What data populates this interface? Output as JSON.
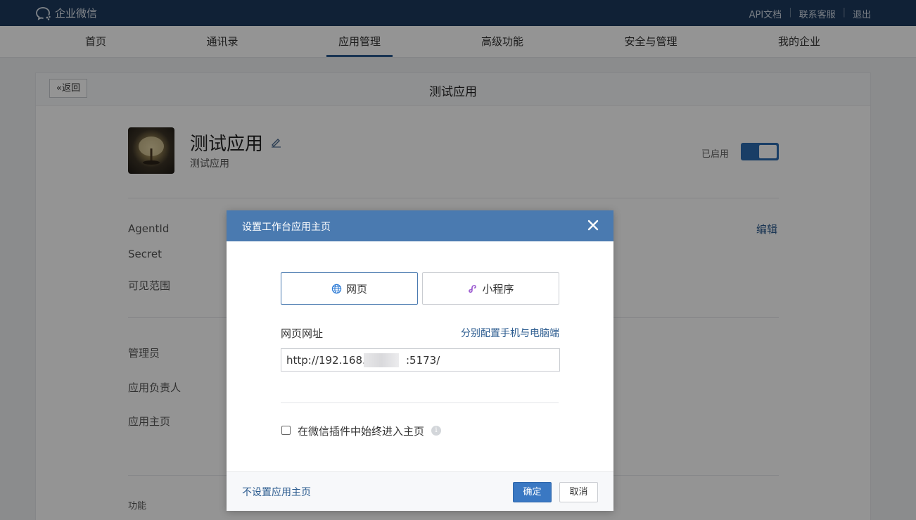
{
  "topbar": {
    "logo_text": "企业微信",
    "links": [
      "API文档",
      "联系客服",
      "退出"
    ]
  },
  "nav": {
    "items": [
      {
        "label": "首页",
        "active": false
      },
      {
        "label": "通讯录",
        "active": false
      },
      {
        "label": "应用管理",
        "active": true
      },
      {
        "label": "高级功能",
        "active": false
      },
      {
        "label": "安全与管理",
        "active": false
      },
      {
        "label": "我的企业",
        "active": false
      }
    ]
  },
  "page": {
    "back_label": "返回",
    "title": "测试应用",
    "app_name": "测试应用",
    "app_description": "测试应用",
    "enabled_label": "已启用",
    "enabled": true,
    "edit_label": "编辑",
    "fields": {
      "agentid": "AgentId",
      "secret": "Secret",
      "visible_range": "可见范围",
      "admin": "管理员",
      "owner": "应用负责人",
      "homepage": "应用主页",
      "features": "功能"
    }
  },
  "dialog": {
    "title": "设置工作台应用主页",
    "tabs": [
      {
        "label": "网页",
        "icon": "globe-icon",
        "selected": true
      },
      {
        "label": "小程序",
        "icon": "mini-program-icon",
        "selected": false
      }
    ],
    "url_label": "网页网址",
    "split_config_link": "分别配置手机与电脑端",
    "url_value": "http://192.168.            :5173/",
    "checkbox_label": "在微信插件中始终进入主页",
    "checkbox_checked": false,
    "no_homepage_link": "不设置应用主页",
    "ok_label": "确定",
    "cancel_label": "取消"
  },
  "colors": {
    "topbar": "#1c3a5e",
    "dialog_header": "#4a7ab0",
    "primary_button": "#3a78c3",
    "link": "#2b5b8f"
  }
}
